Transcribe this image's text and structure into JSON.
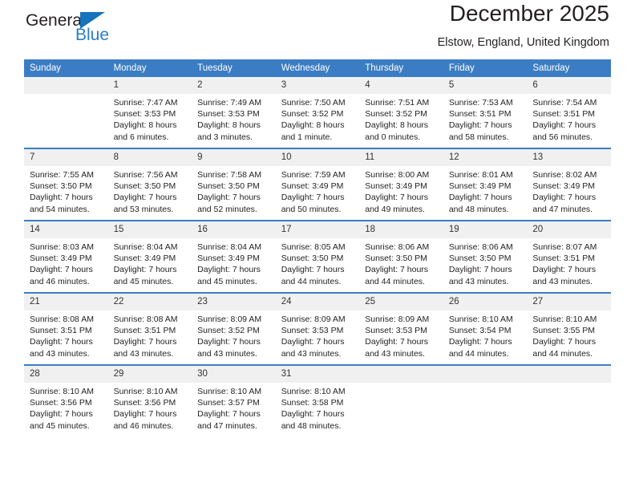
{
  "brand": {
    "name_top": "General",
    "name_bottom": "Blue"
  },
  "header": {
    "title": "December 2025",
    "subtitle": "Elstow, England, United Kingdom"
  },
  "colors": {
    "header_blue": "#3b7dc4",
    "brand_blue": "#2b7fc4",
    "daynum_band": "#f0f0f0",
    "text": "#231f20"
  },
  "weekday_headers": [
    "Sunday",
    "Monday",
    "Tuesday",
    "Wednesday",
    "Thursday",
    "Friday",
    "Saturday"
  ],
  "weeks": [
    [
      {
        "day": "",
        "sunrise": "",
        "sunset": "",
        "daylight": "",
        "empty": true
      },
      {
        "day": "1",
        "sunrise": "Sunrise: 7:47 AM",
        "sunset": "Sunset: 3:53 PM",
        "daylight": "Daylight: 8 hours and 6 minutes."
      },
      {
        "day": "2",
        "sunrise": "Sunrise: 7:49 AM",
        "sunset": "Sunset: 3:53 PM",
        "daylight": "Daylight: 8 hours and 3 minutes."
      },
      {
        "day": "3",
        "sunrise": "Sunrise: 7:50 AM",
        "sunset": "Sunset: 3:52 PM",
        "daylight": "Daylight: 8 hours and 1 minute."
      },
      {
        "day": "4",
        "sunrise": "Sunrise: 7:51 AM",
        "sunset": "Sunset: 3:52 PM",
        "daylight": "Daylight: 8 hours and 0 minutes."
      },
      {
        "day": "5",
        "sunrise": "Sunrise: 7:53 AM",
        "sunset": "Sunset: 3:51 PM",
        "daylight": "Daylight: 7 hours and 58 minutes."
      },
      {
        "day": "6",
        "sunrise": "Sunrise: 7:54 AM",
        "sunset": "Sunset: 3:51 PM",
        "daylight": "Daylight: 7 hours and 56 minutes."
      }
    ],
    [
      {
        "day": "7",
        "sunrise": "Sunrise: 7:55 AM",
        "sunset": "Sunset: 3:50 PM",
        "daylight": "Daylight: 7 hours and 54 minutes."
      },
      {
        "day": "8",
        "sunrise": "Sunrise: 7:56 AM",
        "sunset": "Sunset: 3:50 PM",
        "daylight": "Daylight: 7 hours and 53 minutes."
      },
      {
        "day": "9",
        "sunrise": "Sunrise: 7:58 AM",
        "sunset": "Sunset: 3:50 PM",
        "daylight": "Daylight: 7 hours and 52 minutes."
      },
      {
        "day": "10",
        "sunrise": "Sunrise: 7:59 AM",
        "sunset": "Sunset: 3:49 PM",
        "daylight": "Daylight: 7 hours and 50 minutes."
      },
      {
        "day": "11",
        "sunrise": "Sunrise: 8:00 AM",
        "sunset": "Sunset: 3:49 PM",
        "daylight": "Daylight: 7 hours and 49 minutes."
      },
      {
        "day": "12",
        "sunrise": "Sunrise: 8:01 AM",
        "sunset": "Sunset: 3:49 PM",
        "daylight": "Daylight: 7 hours and 48 minutes."
      },
      {
        "day": "13",
        "sunrise": "Sunrise: 8:02 AM",
        "sunset": "Sunset: 3:49 PM",
        "daylight": "Daylight: 7 hours and 47 minutes."
      }
    ],
    [
      {
        "day": "14",
        "sunrise": "Sunrise: 8:03 AM",
        "sunset": "Sunset: 3:49 PM",
        "daylight": "Daylight: 7 hours and 46 minutes."
      },
      {
        "day": "15",
        "sunrise": "Sunrise: 8:04 AM",
        "sunset": "Sunset: 3:49 PM",
        "daylight": "Daylight: 7 hours and 45 minutes."
      },
      {
        "day": "16",
        "sunrise": "Sunrise: 8:04 AM",
        "sunset": "Sunset: 3:49 PM",
        "daylight": "Daylight: 7 hours and 45 minutes."
      },
      {
        "day": "17",
        "sunrise": "Sunrise: 8:05 AM",
        "sunset": "Sunset: 3:50 PM",
        "daylight": "Daylight: 7 hours and 44 minutes."
      },
      {
        "day": "18",
        "sunrise": "Sunrise: 8:06 AM",
        "sunset": "Sunset: 3:50 PM",
        "daylight": "Daylight: 7 hours and 44 minutes."
      },
      {
        "day": "19",
        "sunrise": "Sunrise: 8:06 AM",
        "sunset": "Sunset: 3:50 PM",
        "daylight": "Daylight: 7 hours and 43 minutes."
      },
      {
        "day": "20",
        "sunrise": "Sunrise: 8:07 AM",
        "sunset": "Sunset: 3:51 PM",
        "daylight": "Daylight: 7 hours and 43 minutes."
      }
    ],
    [
      {
        "day": "21",
        "sunrise": "Sunrise: 8:08 AM",
        "sunset": "Sunset: 3:51 PM",
        "daylight": "Daylight: 7 hours and 43 minutes."
      },
      {
        "day": "22",
        "sunrise": "Sunrise: 8:08 AM",
        "sunset": "Sunset: 3:51 PM",
        "daylight": "Daylight: 7 hours and 43 minutes."
      },
      {
        "day": "23",
        "sunrise": "Sunrise: 8:09 AM",
        "sunset": "Sunset: 3:52 PM",
        "daylight": "Daylight: 7 hours and 43 minutes."
      },
      {
        "day": "24",
        "sunrise": "Sunrise: 8:09 AM",
        "sunset": "Sunset: 3:53 PM",
        "daylight": "Daylight: 7 hours and 43 minutes."
      },
      {
        "day": "25",
        "sunrise": "Sunrise: 8:09 AM",
        "sunset": "Sunset: 3:53 PM",
        "daylight": "Daylight: 7 hours and 43 minutes."
      },
      {
        "day": "26",
        "sunrise": "Sunrise: 8:10 AM",
        "sunset": "Sunset: 3:54 PM",
        "daylight": "Daylight: 7 hours and 44 minutes."
      },
      {
        "day": "27",
        "sunrise": "Sunrise: 8:10 AM",
        "sunset": "Sunset: 3:55 PM",
        "daylight": "Daylight: 7 hours and 44 minutes."
      }
    ],
    [
      {
        "day": "28",
        "sunrise": "Sunrise: 8:10 AM",
        "sunset": "Sunset: 3:56 PM",
        "daylight": "Daylight: 7 hours and 45 minutes."
      },
      {
        "day": "29",
        "sunrise": "Sunrise: 8:10 AM",
        "sunset": "Sunset: 3:56 PM",
        "daylight": "Daylight: 7 hours and 46 minutes."
      },
      {
        "day": "30",
        "sunrise": "Sunrise: 8:10 AM",
        "sunset": "Sunset: 3:57 PM",
        "daylight": "Daylight: 7 hours and 47 minutes."
      },
      {
        "day": "31",
        "sunrise": "Sunrise: 8:10 AM",
        "sunset": "Sunset: 3:58 PM",
        "daylight": "Daylight: 7 hours and 48 minutes."
      },
      {
        "day": "",
        "sunrise": "",
        "sunset": "",
        "daylight": "",
        "empty": true
      },
      {
        "day": "",
        "sunrise": "",
        "sunset": "",
        "daylight": "",
        "empty": true
      },
      {
        "day": "",
        "sunrise": "",
        "sunset": "",
        "daylight": "",
        "empty": true
      }
    ]
  ]
}
